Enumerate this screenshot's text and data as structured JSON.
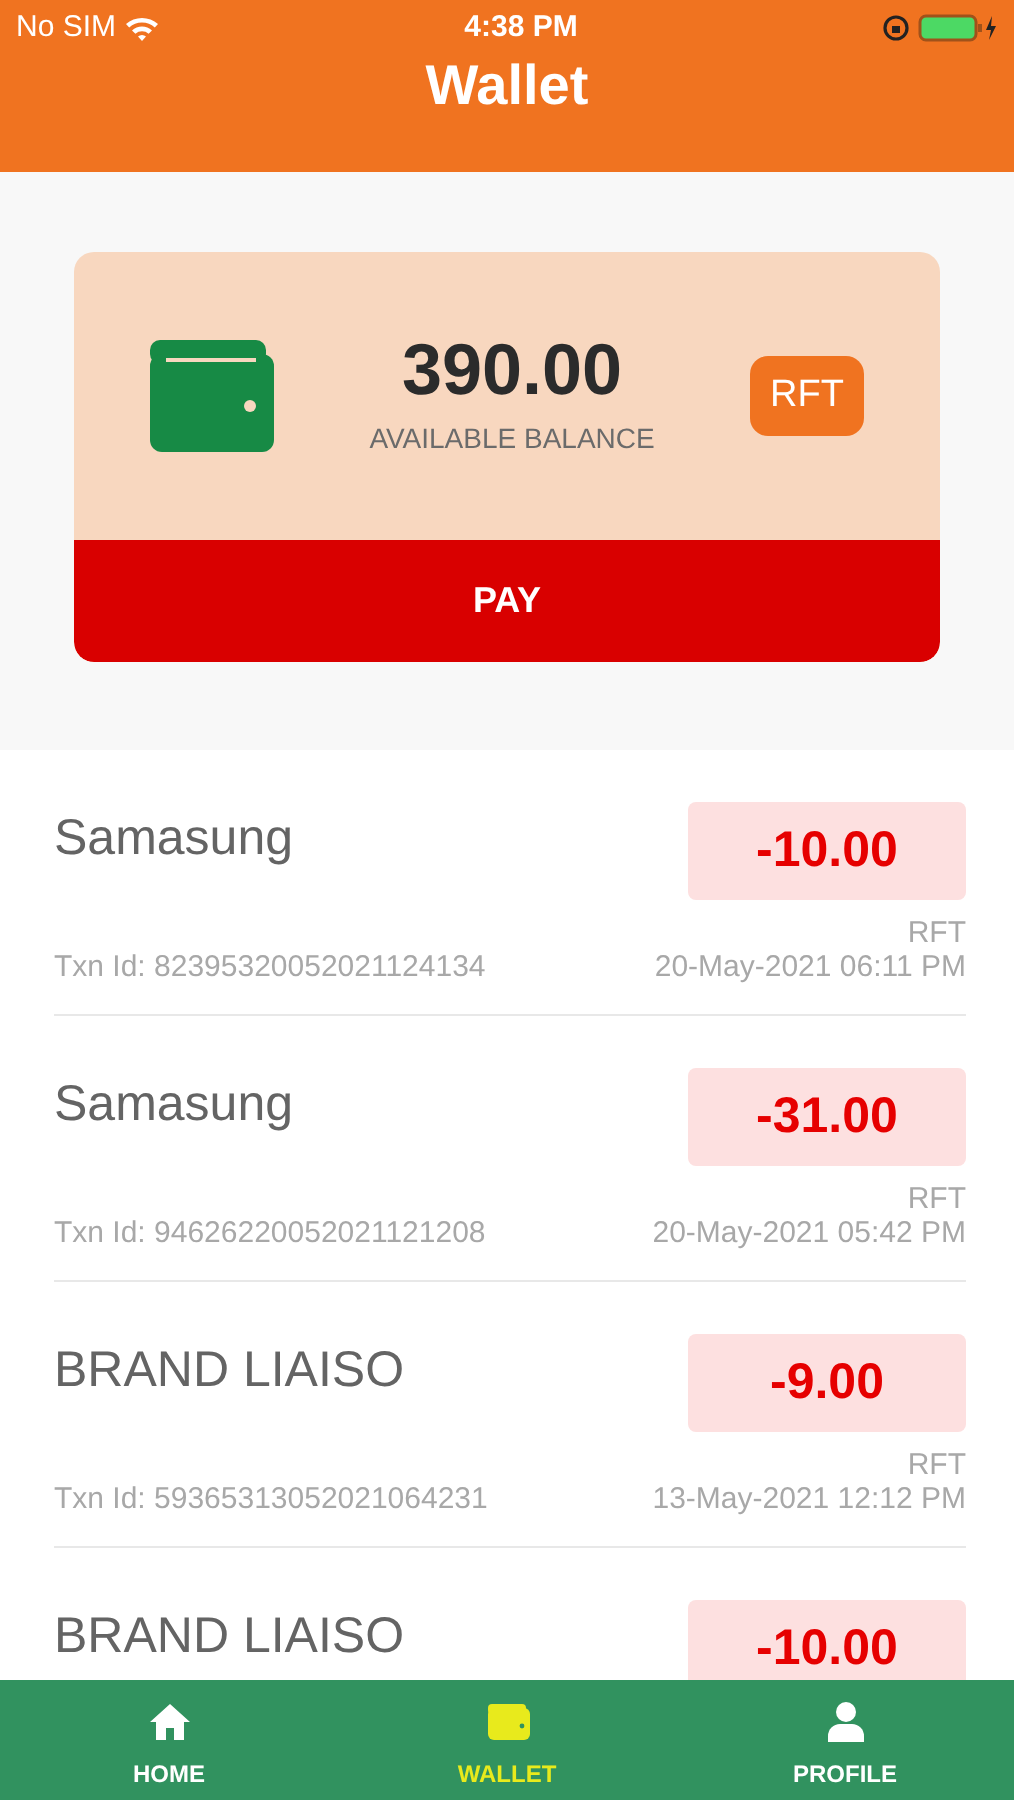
{
  "status_bar": {
    "carrier": "No SIM",
    "time": "4:38 PM"
  },
  "header": {
    "title": "Wallet"
  },
  "balance_card": {
    "amount": "390.00",
    "label": "AVAILABLE BALANCE",
    "currency": "RFT",
    "pay_button": "PAY"
  },
  "transactions": [
    {
      "name": "Samasung",
      "amount": "-10.00",
      "currency": "RFT",
      "txn_id": "Txn Id: 82395320052021124134",
      "date": "20-May-2021 06:11 PM"
    },
    {
      "name": "Samasung",
      "amount": "-31.00",
      "currency": "RFT",
      "txn_id": "Txn Id: 94626220052021121208",
      "date": "20-May-2021 05:42 PM"
    },
    {
      "name": "BRAND LIAISO",
      "amount": "-9.00",
      "currency": "RFT",
      "txn_id": "Txn Id: 59365313052021064231",
      "date": "13-May-2021 12:12 PM"
    },
    {
      "name": "BRAND LIAISO",
      "amount": "-10.00"
    }
  ],
  "tab_bar": [
    {
      "kind": "home",
      "label": "HOME",
      "selected": false
    },
    {
      "kind": "wallet",
      "label": "WALLET",
      "selected": true
    },
    {
      "kind": "profile",
      "label": "PROFILE",
      "selected": false
    }
  ]
}
